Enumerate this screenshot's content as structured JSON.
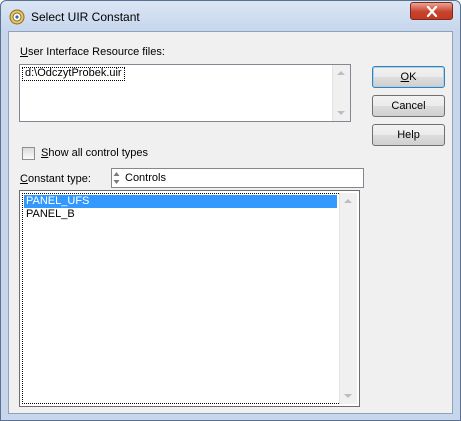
{
  "window": {
    "title": "Select UIR Constant",
    "app_icon": "labwindows-cvi-icon",
    "close_icon": "close-x-icon"
  },
  "uir_files": {
    "label_prefix": "U",
    "label_rest": "ser Interface Resource files:",
    "items": [
      "d:\\OdczytProbek.uir"
    ]
  },
  "buttons": {
    "ok_underlined": "O",
    "ok_rest": "K",
    "cancel": "Cancel",
    "help": "Help"
  },
  "show_all": {
    "label_prefix": "S",
    "label_rest": "how all control types",
    "checked": false
  },
  "constant_type": {
    "label_prefix": "C",
    "label_rest": "onstant type:",
    "value": "Controls"
  },
  "constants": {
    "items": [
      "PANEL_UFS",
      "PANEL_B"
    ],
    "selected_index": 0
  },
  "colors": {
    "selection": "#3399ff",
    "frame": "#c7d6ea",
    "close_button": "#c7422c"
  }
}
